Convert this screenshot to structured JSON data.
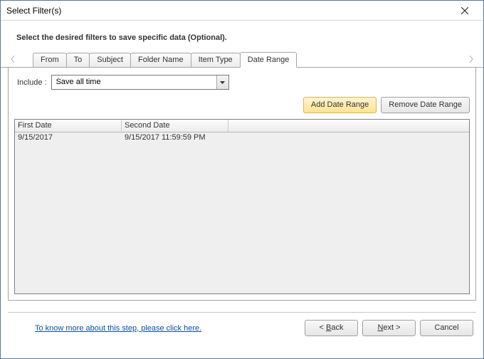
{
  "window": {
    "title": "Select Filter(s)"
  },
  "instruction": "Select the desired filters to save specific data (Optional).",
  "tabs": {
    "items": [
      "From",
      "To",
      "Subject",
      "Folder Name",
      "Item Type",
      "Date Range"
    ],
    "active_index": 5
  },
  "include": {
    "label": "Include :",
    "selected": "Save all time"
  },
  "buttons": {
    "add_range": "Add Date Range",
    "remove_range": "Remove Date Range"
  },
  "grid": {
    "columns": [
      "First Date",
      "Second Date"
    ],
    "rows": [
      {
        "first": "9/15/2017",
        "second": "9/15/2017 11:59:59 PM"
      }
    ]
  },
  "footer": {
    "link": "To know more about this step, please click here.",
    "back_prefix": "< ",
    "back_u": "B",
    "back_rest": "ack",
    "next_u": "N",
    "next_rest": "ext >",
    "cancel": "Cancel"
  }
}
